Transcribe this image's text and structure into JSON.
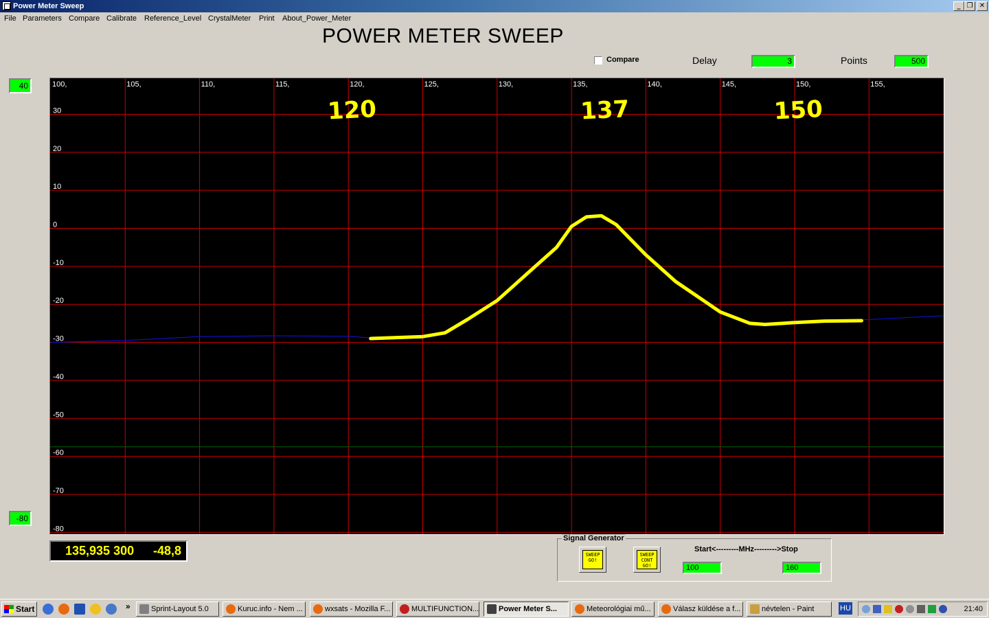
{
  "window": {
    "title": "Power Meter Sweep"
  },
  "menu": [
    "File",
    "Parameters",
    "Compare",
    "Calibrate",
    "Reference_Level",
    "CrystalMeter",
    "Print",
    "About_Power_Meter"
  ],
  "heading": "POWER METER SWEEP",
  "controls": {
    "compare_label": "Compare",
    "compare_checked": false,
    "delay_label": "Delay",
    "delay_value": "3",
    "points_label": "Points",
    "points_value": "500"
  },
  "reference_levels": {
    "top": "40",
    "bottom": "-80"
  },
  "readout": {
    "frequency": "135,935 300",
    "level": "-48,8"
  },
  "signal_generator": {
    "title": "Signal Generator",
    "sweep_go_label": "SWEEP\nGO!",
    "sweep_cont_label": "SWEEP\nCONT\nGO!",
    "range_label": "Start<---------MHz--------->Stop",
    "start_value": "100",
    "stop_value": "160"
  },
  "chart_data": {
    "type": "line",
    "x_ticks": [
      "100,",
      "105,",
      "110,",
      "115,",
      "120,",
      "125,",
      "130,",
      "135,",
      "140,",
      "145,",
      "150,",
      "155,"
    ],
    "y_ticks": [
      "30",
      "20",
      "10",
      "0",
      "-10",
      "-20",
      "-30",
      "-40",
      "-50",
      "-60",
      "-70",
      "-80"
    ],
    "xlim": [
      100,
      160
    ],
    "ylim": [
      -80,
      40
    ],
    "grid": true,
    "colors": {
      "background": "#000000",
      "grid": "#cc0000",
      "trace": "#1010c8",
      "annotation": "#ffff00",
      "marker_line": "#006400",
      "labels": "#ffffff"
    },
    "reference_line_y": -57.5,
    "series": [
      {
        "x": [
          100,
          105,
          110,
          115,
          120,
          122,
          125,
          126.5,
          128,
          130,
          132,
          134,
          135,
          136,
          137,
          138,
          140,
          142,
          145,
          147,
          148,
          150,
          152,
          155,
          160
        ],
        "y": [
          -30,
          -29.5,
          -28.5,
          -28.3,
          -28.4,
          -29,
          -28.5,
          -27.5,
          -24,
          -19,
          -12,
          -5,
          0.5,
          3,
          3.3,
          1,
          -7,
          -14,
          -22,
          -25,
          -25.3,
          -24.8,
          -24.4,
          -24,
          -23
        ]
      }
    ],
    "annotations": [
      {
        "text": "120",
        "x": 120
      },
      {
        "text": "137",
        "x": 137
      },
      {
        "text": "150",
        "x": 150
      }
    ],
    "highlight": {
      "x": [
        121.5,
        125,
        126.5,
        128,
        130,
        132,
        134,
        135,
        136,
        137,
        138,
        140,
        142,
        145,
        147,
        148,
        150,
        152,
        154.5
      ],
      "y": [
        -29,
        -28.5,
        -27.5,
        -24,
        -19,
        -12,
        -5,
        0.5,
        3,
        3.3,
        1,
        -7,
        -14,
        -22,
        -25,
        -25.3,
        -24.8,
        -24.4,
        -24.3
      ]
    }
  },
  "taskbar": {
    "start_label": "Start",
    "more": "»",
    "tasks": [
      {
        "label": "Sprint-Layout 5.0",
        "icon": "app-icon"
      },
      {
        "label": "Kuruc.info - Nem ...",
        "icon": "firefox-icon"
      },
      {
        "label": "wxsats - Mozilla F...",
        "icon": "firefox-icon"
      },
      {
        "label": "MULTIFUNCTION...",
        "icon": "app-icon"
      },
      {
        "label": "Power Meter S...",
        "icon": "app-icon",
        "active": true
      },
      {
        "label": "Meteorológiai mű...",
        "icon": "firefox-icon"
      },
      {
        "label": "Válasz küldése a f...",
        "icon": "firefox-icon"
      },
      {
        "label": "névtelen - Paint",
        "icon": "paint-icon"
      }
    ],
    "language": "HU",
    "clock": "21:40"
  }
}
